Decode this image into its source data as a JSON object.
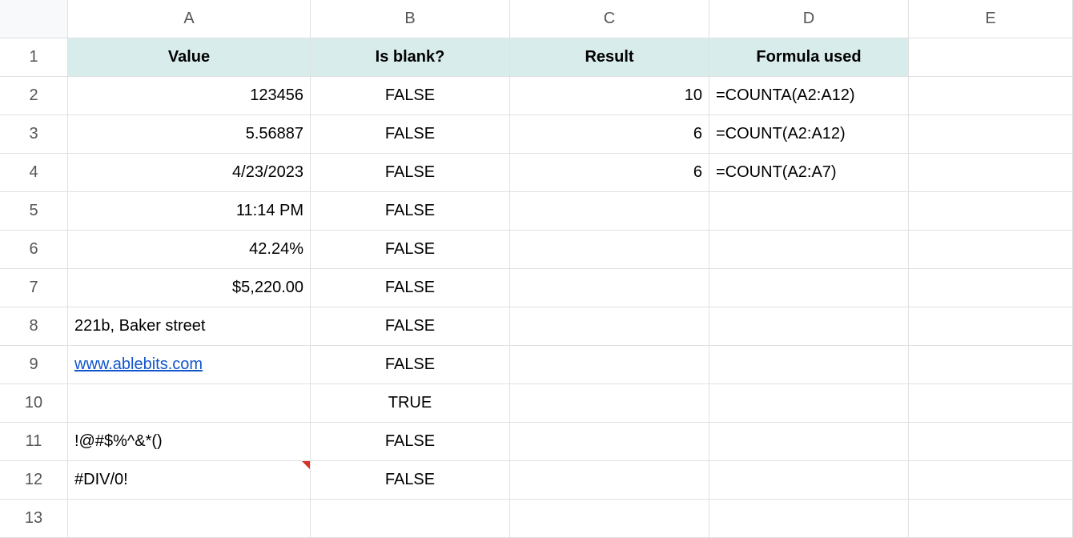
{
  "columns": [
    "A",
    "B",
    "C",
    "D",
    "E"
  ],
  "row_count": 13,
  "headers": {
    "A": "Value",
    "B": "Is blank?",
    "C": "Result",
    "D": "Formula used"
  },
  "rows": [
    {
      "A": "123456",
      "B": "FALSE",
      "C": "10",
      "D": "=COUNTA(A2:A12)"
    },
    {
      "A": "5.56887",
      "B": "FALSE",
      "C": "6",
      "D": "=COUNT(A2:A12)"
    },
    {
      "A": "4/23/2023",
      "B": "FALSE",
      "C": "6",
      "D": "=COUNT(A2:A7)"
    },
    {
      "A": "11:14 PM",
      "B": "FALSE",
      "C": "",
      "D": ""
    },
    {
      "A": "42.24%",
      "B": "FALSE",
      "C": "",
      "D": ""
    },
    {
      "A": "$5,220.00",
      "B": "FALSE",
      "C": "",
      "D": ""
    },
    {
      "A": "221b, Baker street",
      "B": "FALSE",
      "C": "",
      "D": "",
      "A_align": "left"
    },
    {
      "A": "www.ablebits.com",
      "B": "FALSE",
      "C": "",
      "D": "",
      "A_link": true,
      "A_align": "left"
    },
    {
      "A": "",
      "B": "TRUE",
      "C": "",
      "D": ""
    },
    {
      "A": "!@#$%^&*()",
      "B": "FALSE",
      "C": "",
      "D": "",
      "A_align": "left"
    },
    {
      "A": "#DIV/0!",
      "B": "FALSE",
      "C": "",
      "D": "",
      "A_error": true,
      "A_indent": true
    }
  ]
}
